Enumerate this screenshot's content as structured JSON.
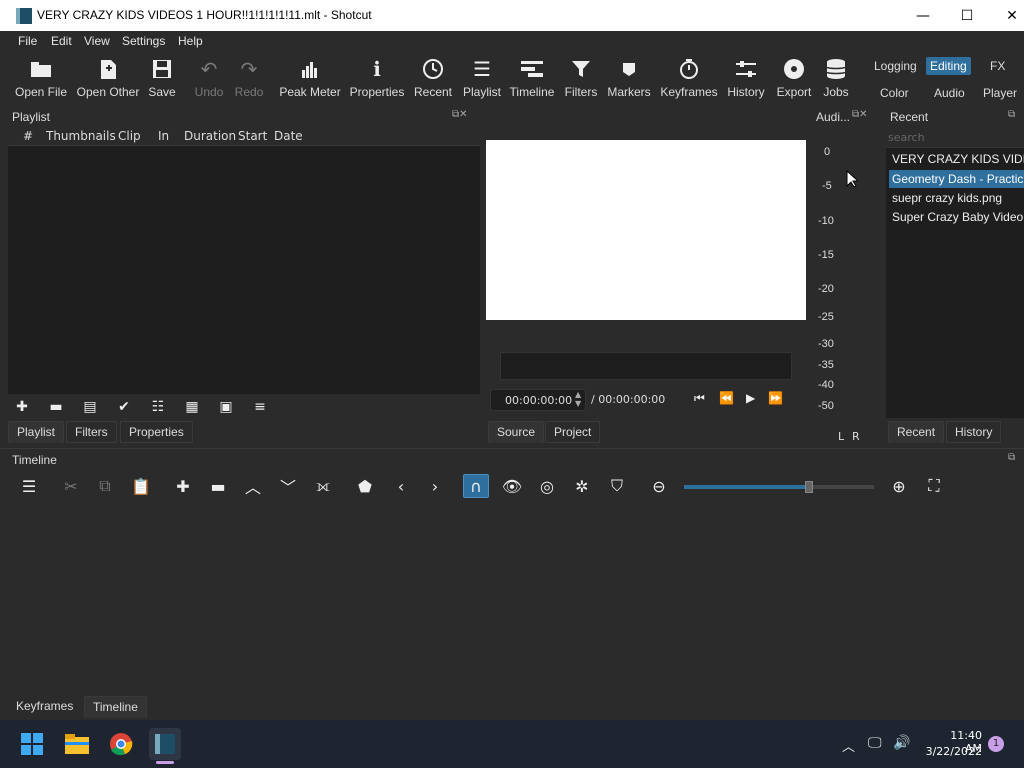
{
  "window": {
    "title": "VERY CRAZY KIDS VIDEOS 1 HOUR!!1!1!1!1!11.mlt - Shotcut",
    "minimize": "—",
    "maximize": "☐",
    "close": "✕"
  },
  "menu": {
    "file": "File",
    "edit": "Edit",
    "view": "View",
    "settings": "Settings",
    "help": "Help"
  },
  "toolbar": {
    "open_file": "Open File",
    "open_other": "Open Other",
    "save": "Save",
    "undo": "Undo",
    "redo": "Redo",
    "peak_meter": "Peak Meter",
    "properties": "Properties",
    "recent": "Recent",
    "playlist": "Playlist",
    "timeline": "Timeline",
    "filters": "Filters",
    "markers": "Markers",
    "keyframes": "Keyframes",
    "history": "History",
    "export": "Export",
    "jobs": "Jobs"
  },
  "layouts": {
    "logging": "Logging",
    "editing": "Editing",
    "fx": "FX",
    "color": "Color",
    "audio": "Audio",
    "player": "Player"
  },
  "playlist": {
    "title": "Playlist",
    "columns": [
      "#",
      "Thumbnails",
      "Clip",
      "In",
      "Duration",
      "Start",
      "Date"
    ],
    "tabs": [
      "Playlist",
      "Filters",
      "Properties"
    ]
  },
  "player": {
    "timecode": "00:00:00:00",
    "duration": "/ 00:00:00:00",
    "tabs": [
      "Source",
      "Project"
    ]
  },
  "audio": {
    "title": "Audi...",
    "scale": [
      "0",
      "-5",
      "-10",
      "-15",
      "-20",
      "-25",
      "-30",
      "-35",
      "-40",
      "-50"
    ],
    "left": "L",
    "right": "R"
  },
  "recent": {
    "title": "Recent",
    "search_placeholder": "search",
    "items": [
      "VERY CRAZY KIDS VIDE...",
      "Geometry Dash - Practic...",
      "suepr crazy kids.png",
      "Super Crazy Baby Video..."
    ],
    "tabs": [
      "Recent",
      "History"
    ]
  },
  "timeline": {
    "title": "Timeline",
    "tabs": [
      "Keyframes",
      "Timeline"
    ],
    "zoom_level": 0.2
  },
  "taskbar": {
    "time": "11:40 AM",
    "date": "3/22/2022",
    "notifications": "1"
  },
  "colors": {
    "accent": "#2e6f9e",
    "panel_dark": "#1e1e1e",
    "background": "#2b2b2b"
  }
}
